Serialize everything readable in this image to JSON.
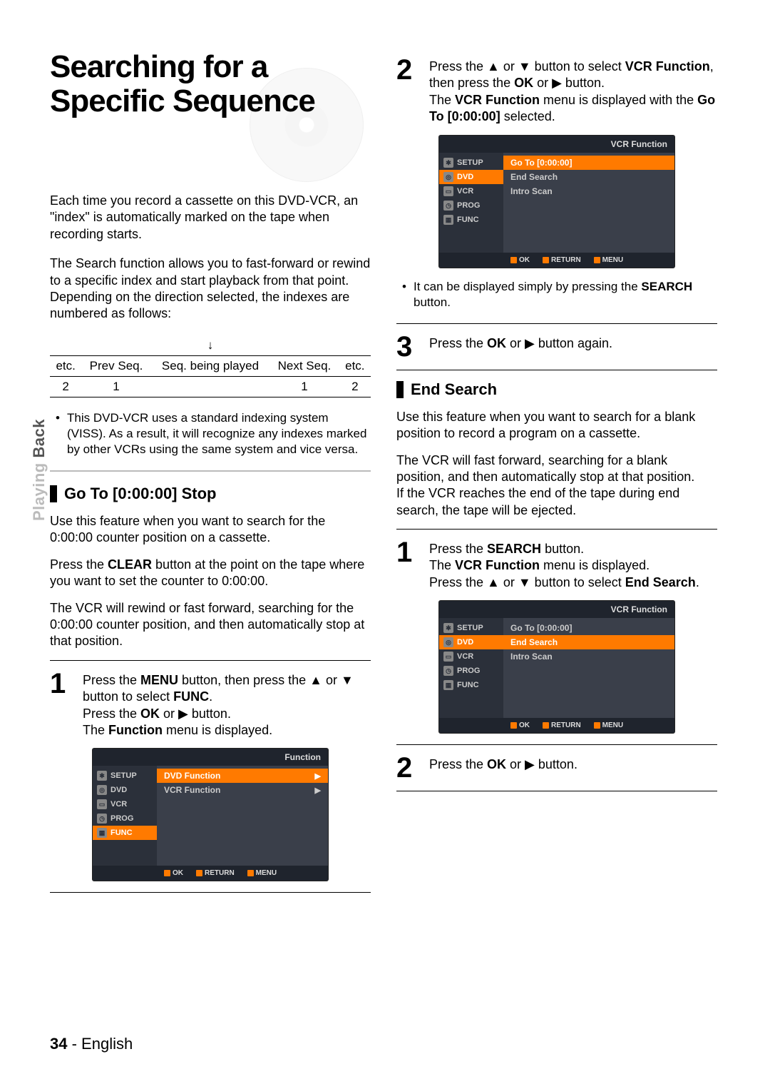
{
  "sideTab": {
    "light": "Playing ",
    "dark": "Back"
  },
  "title": "Searching for a Specific Sequence",
  "intro1": "Each time you record a cassette on this DVD-VCR, an \"index\" is automatically marked on the tape when recording starts.",
  "intro2": "The Search function allows you to fast-forward or rewind to a specific index and start playback from that point. Depending on the direction selected, the indexes are numbered as follows:",
  "idxArrow": "↓",
  "idxHeaders": [
    "etc.",
    "Prev Seq.",
    "Seq. being played",
    "Next Seq.",
    "etc."
  ],
  "idxValues": [
    "",
    "2",
    "1",
    "1",
    "2",
    ""
  ],
  "viss": "This DVD-VCR uses a standard indexing system (VISS). As a result, it will recognize any indexes marked by other VCRs using the same system and vice versa.",
  "sub1": "Go To [0:00:00] Stop",
  "goto_p1": "Use this feature when you want to search for the 0:00:00 counter position on a cassette.",
  "goto_p2_a": "Press the ",
  "goto_p2_b": "CLEAR",
  "goto_p2_c": " button at the point on the tape where you want to set the counter to 0:00:00.",
  "goto_p3": "The VCR will rewind or fast forward, searching for the 0:00:00 counter position, and then automatically stop at that position.",
  "step1": {
    "a": "Press the ",
    "menu": "MENU",
    "b": " button, then press the ▲ or ▼ button to select ",
    "func": "FUNC",
    "c": ".",
    "d": "Press the ",
    "ok": "OK",
    "e": " or ▶ button.",
    "f": "The ",
    "fm": "Function",
    "g": " menu is displayed."
  },
  "osd1": {
    "title": "Function",
    "side": [
      "SETUP",
      "DVD",
      "VCR",
      "PROG",
      "FUNC"
    ],
    "rows": [
      {
        "label": "DVD Function",
        "hl": true,
        "arrow": true
      },
      {
        "label": "VCR Function",
        "hl": false,
        "arrow": true
      }
    ],
    "foot": [
      "OK",
      "RETURN",
      "MENU"
    ]
  },
  "step2r": {
    "a": "Press the ▲ or ▼ button to select ",
    "vcrf": "VCR Function",
    "b": ", then press the ",
    "ok": "OK",
    "c": " or ▶ button.",
    "d": "The ",
    "vcrf2": "VCR Function",
    "e": " menu is displayed with the ",
    "goto": "Go To [0:00:00]",
    "f": " selected."
  },
  "osd2": {
    "title": "VCR Function",
    "side": [
      "SETUP",
      "DVD",
      "VCR",
      "PROG",
      "FUNC"
    ],
    "rows": [
      {
        "label": "Go To [0:00:00]",
        "hl": true
      },
      {
        "label": "End Search",
        "hl": false
      },
      {
        "label": "Intro Scan",
        "hl": false
      }
    ],
    "foot": [
      "OK",
      "RETURN",
      "MENU"
    ]
  },
  "searchNote_a": "It can be displayed simply by pressing the ",
  "searchNote_b": "SEARCH",
  "searchNote_c": " button.",
  "step3r": {
    "a": "Press the ",
    "ok": "OK",
    "b": " or ▶ button again."
  },
  "sub2": "End Search",
  "end_p1": "Use this feature when you want to search for a blank position to record a program on a cassette.",
  "end_p2": "The VCR will fast forward, searching for a blank position, and then automatically stop at that position.\nIf the VCR reaches the end of the tape during end search, the tape will be ejected.",
  "endstep1": {
    "a": "Press the ",
    "search": "SEARCH",
    "b": " button.",
    "c": "The ",
    "vcrf": "VCR Function",
    "d": " menu is displayed.",
    "e": "Press the ▲ or ▼ button to select ",
    "es": "End Search",
    "f": "."
  },
  "osd3": {
    "title": "VCR Function",
    "side": [
      "SETUP",
      "DVD",
      "VCR",
      "PROG",
      "FUNC"
    ],
    "rows": [
      {
        "label": "Go To [0:00:00]",
        "hl": false
      },
      {
        "label": "End Search",
        "hl": true
      },
      {
        "label": "Intro Scan",
        "hl": false
      }
    ],
    "foot": [
      "OK",
      "RETURN",
      "MENU"
    ]
  },
  "endstep2": {
    "a": "Press the ",
    "ok": "OK",
    "b": " or ▶ button."
  },
  "footer": {
    "page": "34",
    "sep": " - ",
    "lang": "English"
  }
}
